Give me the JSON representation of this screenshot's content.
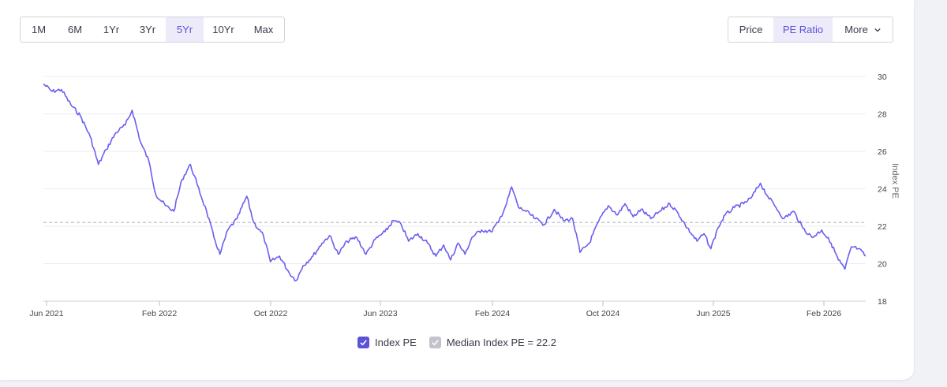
{
  "range_buttons": [
    {
      "label": "1M",
      "active": false
    },
    {
      "label": "6M",
      "active": false
    },
    {
      "label": "1Yr",
      "active": false
    },
    {
      "label": "3Yr",
      "active": false
    },
    {
      "label": "5Yr",
      "active": true
    },
    {
      "label": "10Yr",
      "active": false
    },
    {
      "label": "Max",
      "active": false
    }
  ],
  "view_buttons": {
    "price": "Price",
    "pe_ratio": "PE Ratio",
    "more": "More"
  },
  "legend": {
    "series1": "Index PE",
    "series2": "Median Index PE = 22.2"
  },
  "colors": {
    "accent": "#5b52d6",
    "line": "#6a5ff0",
    "median": "#b5b5be",
    "checkbox_gray": "#c3c3cb"
  },
  "chart_data": {
    "type": "line",
    "ylabel": "Index PE",
    "ylim": [
      18,
      30
    ],
    "yticks": [
      "18",
      "20",
      "22",
      "24",
      "26",
      "28",
      "30"
    ],
    "xticks": [
      "Jun 2021",
      "Feb 2022",
      "Oct 2022",
      "Jun 2023",
      "Feb 2024",
      "Oct 2024",
      "Jun 2025",
      "Feb 2026"
    ],
    "x_range": [
      "2021-06-01",
      "2026-04-15"
    ],
    "median": 22.2,
    "series": [
      {
        "name": "Index PE",
        "points": [
          [
            "2021-06-01",
            29.6
          ],
          [
            "2021-06-20",
            29.2
          ],
          [
            "2021-07-10",
            29.3
          ],
          [
            "2021-07-30",
            28.5
          ],
          [
            "2021-08-20",
            27.9
          ],
          [
            "2021-09-10",
            26.8
          ],
          [
            "2021-09-28",
            25.3
          ],
          [
            "2021-10-15",
            26.1
          ],
          [
            "2021-11-05",
            27.0
          ],
          [
            "2021-11-25",
            27.4
          ],
          [
            "2021-12-10",
            28.2
          ],
          [
            "2021-12-28",
            26.5
          ],
          [
            "2022-01-15",
            25.5
          ],
          [
            "2022-01-30",
            23.7
          ],
          [
            "2022-02-20",
            23.1
          ],
          [
            "2022-03-10",
            22.8
          ],
          [
            "2022-03-28",
            24.5
          ],
          [
            "2022-04-15",
            25.3
          ],
          [
            "2022-04-30",
            24.2
          ],
          [
            "2022-05-20",
            22.8
          ],
          [
            "2022-06-05",
            21.4
          ],
          [
            "2022-06-18",
            20.5
          ],
          [
            "2022-07-05",
            21.8
          ],
          [
            "2022-07-25",
            22.4
          ],
          [
            "2022-08-15",
            23.6
          ],
          [
            "2022-08-30",
            22.2
          ],
          [
            "2022-09-20",
            21.5
          ],
          [
            "2022-10-05",
            20.1
          ],
          [
            "2022-10-25",
            20.4
          ],
          [
            "2022-11-15",
            19.5
          ],
          [
            "2022-11-30",
            19.1
          ],
          [
            "2022-12-15",
            19.9
          ],
          [
            "2023-01-05",
            20.4
          ],
          [
            "2023-01-25",
            21.1
          ],
          [
            "2023-02-10",
            21.5
          ],
          [
            "2023-03-01",
            20.5
          ],
          [
            "2023-03-20",
            21.2
          ],
          [
            "2023-04-10",
            21.4
          ],
          [
            "2023-04-30",
            20.5
          ],
          [
            "2023-05-20",
            21.3
          ],
          [
            "2023-06-10",
            21.7
          ],
          [
            "2023-06-28",
            22.3
          ],
          [
            "2023-07-15",
            22.1
          ],
          [
            "2023-07-31",
            21.2
          ],
          [
            "2023-08-20",
            21.6
          ],
          [
            "2023-09-10",
            21.1
          ],
          [
            "2023-09-28",
            20.4
          ],
          [
            "2023-10-15",
            21.0
          ],
          [
            "2023-10-30",
            20.2
          ],
          [
            "2023-11-15",
            21.1
          ],
          [
            "2023-11-30",
            20.5
          ],
          [
            "2023-12-15",
            21.4
          ],
          [
            "2024-01-05",
            21.8
          ],
          [
            "2024-01-25",
            21.7
          ],
          [
            "2024-02-10",
            22.2
          ],
          [
            "2024-02-28",
            23.2
          ],
          [
            "2024-03-10",
            24.1
          ],
          [
            "2024-03-25",
            23.0
          ],
          [
            "2024-04-10",
            22.8
          ],
          [
            "2024-04-30",
            22.4
          ],
          [
            "2024-05-20",
            22.1
          ],
          [
            "2024-06-10",
            22.9
          ],
          [
            "2024-06-30",
            22.3
          ],
          [
            "2024-07-20",
            22.4
          ],
          [
            "2024-08-05",
            20.6
          ],
          [
            "2024-08-25",
            21.1
          ],
          [
            "2024-09-15",
            22.3
          ],
          [
            "2024-10-05",
            23.1
          ],
          [
            "2024-10-25",
            22.6
          ],
          [
            "2024-11-10",
            23.2
          ],
          [
            "2024-11-28",
            22.5
          ],
          [
            "2024-12-15",
            22.9
          ],
          [
            "2025-01-05",
            22.4
          ],
          [
            "2025-01-25",
            22.8
          ],
          [
            "2025-02-15",
            23.2
          ],
          [
            "2025-03-05",
            22.7
          ],
          [
            "2025-03-25",
            21.9
          ],
          [
            "2025-04-15",
            21.2
          ],
          [
            "2025-04-30",
            21.6
          ],
          [
            "2025-05-15",
            20.8
          ],
          [
            "2025-05-30",
            21.9
          ],
          [
            "2025-06-15",
            22.6
          ],
          [
            "2025-07-05",
            23.0
          ],
          [
            "2025-07-25",
            23.2
          ],
          [
            "2025-08-10",
            23.5
          ],
          [
            "2025-08-30",
            24.3
          ],
          [
            "2025-09-15",
            23.6
          ],
          [
            "2025-09-30",
            23.1
          ],
          [
            "2025-10-20",
            22.4
          ],
          [
            "2025-11-10",
            22.8
          ],
          [
            "2025-11-30",
            21.9
          ],
          [
            "2025-12-20",
            21.4
          ],
          [
            "2026-01-10",
            21.8
          ],
          [
            "2026-01-30",
            21.1
          ],
          [
            "2026-02-15",
            20.2
          ],
          [
            "2026-03-01",
            19.7
          ],
          [
            "2026-03-15",
            20.9
          ],
          [
            "2026-03-30",
            20.8
          ],
          [
            "2026-04-15",
            20.4
          ]
        ]
      }
    ]
  }
}
